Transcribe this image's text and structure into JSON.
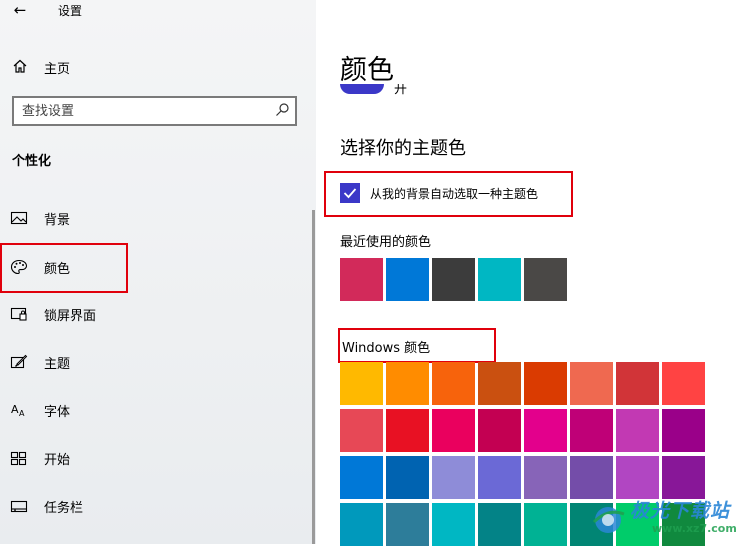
{
  "app": {
    "title": "设置",
    "back_icon": "arrow-left-icon"
  },
  "sidebar": {
    "home_label": "主页",
    "search_placeholder": "查找设置",
    "section_title": "个性化",
    "items": [
      {
        "label": "背景",
        "icon": "image-icon"
      },
      {
        "label": "颜色",
        "icon": "palette-icon",
        "active": true
      },
      {
        "label": "锁屏界面",
        "icon": "lock-screen-icon"
      },
      {
        "label": "主题",
        "icon": "theme-brush-icon"
      },
      {
        "label": "字体",
        "icon": "font-icon"
      },
      {
        "label": "开始",
        "icon": "start-icon"
      },
      {
        "label": "任务栏",
        "icon": "taskbar-icon"
      }
    ]
  },
  "main": {
    "page_title": "颜色",
    "toggle_state_text": "开",
    "accent_heading": "选择你的主题色",
    "auto_pick_label": "从我的背景自动选取一种主题色",
    "auto_pick_checked": true,
    "recent_heading": "最近使用的颜色",
    "recent_colors": [
      "#d22a5a",
      "#0078d7",
      "#3c3c3c",
      "#00b7c3",
      "#4a4846"
    ],
    "windows_heading": "Windows 颜色",
    "windows_colors": [
      [
        "#ffb900",
        "#ff8c00",
        "#f7630c",
        "#ca5010",
        "#da3b01",
        "#ef6950",
        "#d13438",
        "#ff4343"
      ],
      [
        "#e74856",
        "#e81123",
        "#ea005e",
        "#c30052",
        "#e3008c",
        "#bf0077",
        "#c239b3",
        "#9a0089"
      ],
      [
        "#0078d7",
        "#0063b1",
        "#8e8cd8",
        "#6b69d6",
        "#8764b8",
        "#744da9",
        "#b146c2",
        "#881798"
      ],
      [
        "#0099bc",
        "#2d7d9a",
        "#00b7c3",
        "#038387",
        "#00b294",
        "#018574",
        "#00cc6a",
        "#10893e"
      ]
    ]
  },
  "colors": {
    "accent": "#3b38c8",
    "highlight_box": "#e0000c"
  },
  "watermark": {
    "name": "极光下载站",
    "url": "www.xz7.com"
  }
}
